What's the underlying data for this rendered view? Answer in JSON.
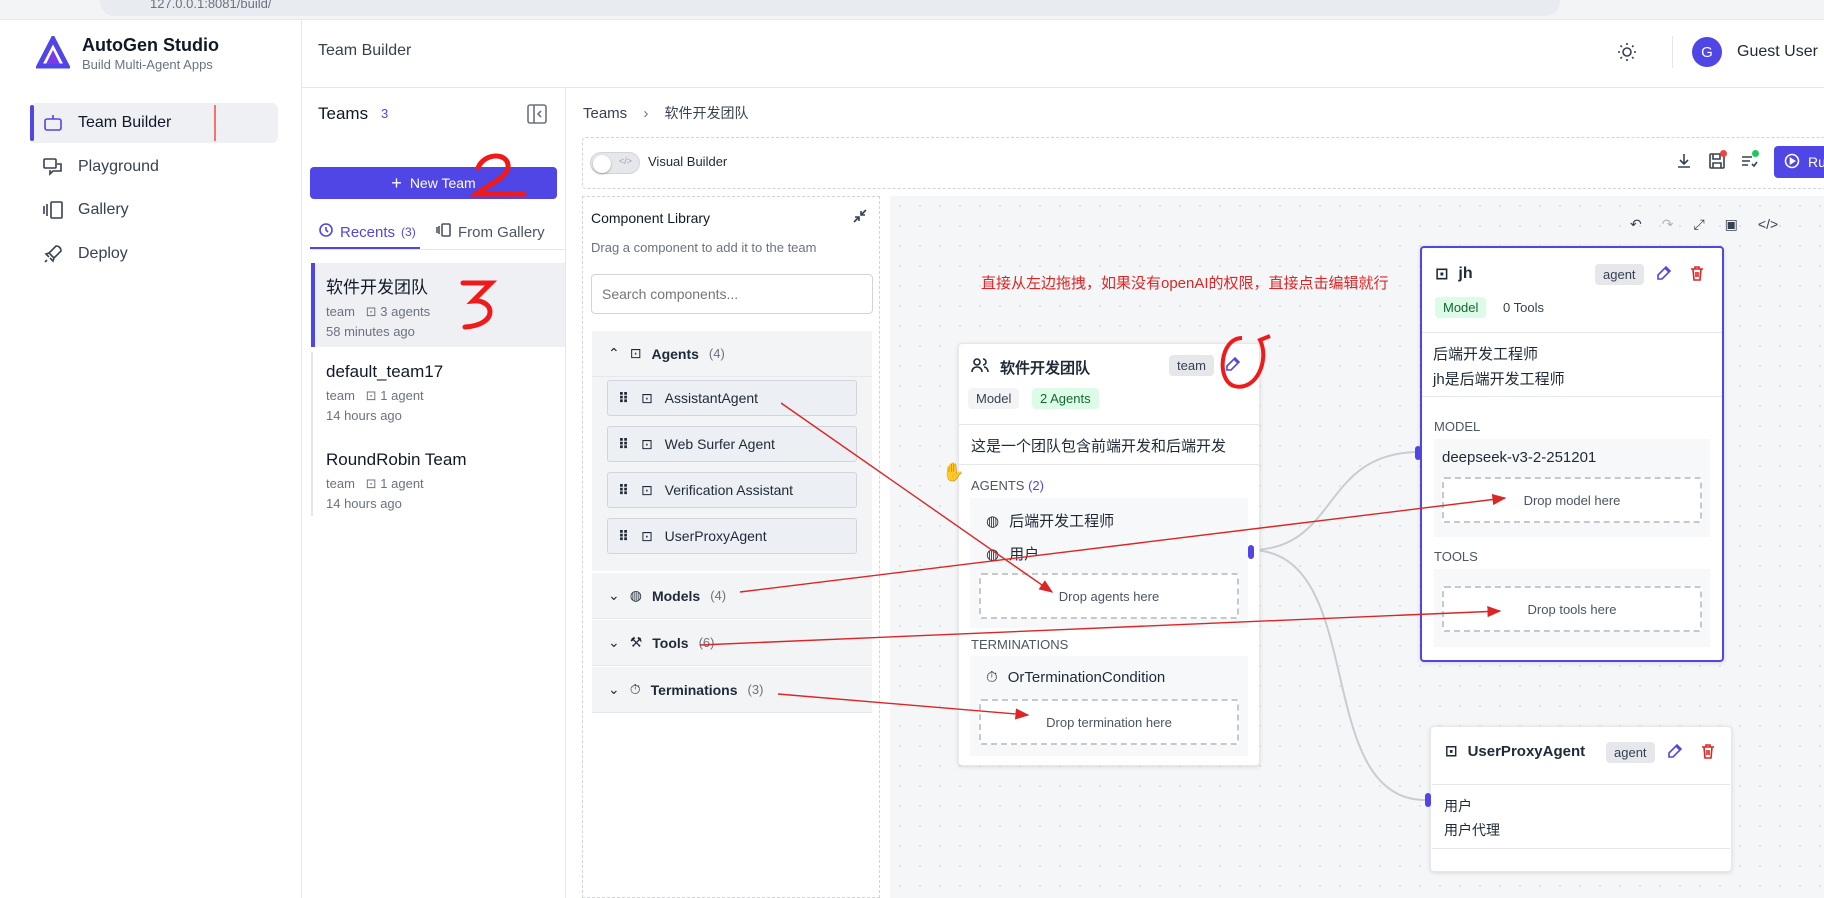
{
  "browser": {
    "url": "127.0.0.1:8081/build/"
  },
  "app": {
    "title": "AutoGen Studio",
    "subtitle": "Build Multi-Agent Apps"
  },
  "nav": {
    "items": [
      {
        "label": "Team Builder",
        "icon": "bot-icon",
        "active": true
      },
      {
        "label": "Playground",
        "icon": "chat-icon",
        "active": false
      },
      {
        "label": "Gallery",
        "icon": "gallery-icon",
        "active": false
      },
      {
        "label": "Deploy",
        "icon": "rocket-icon",
        "active": false
      }
    ]
  },
  "header": {
    "title": "Team Builder",
    "user_initial": "G",
    "user_name": "Guest User"
  },
  "teams": {
    "title": "Teams",
    "count": "3",
    "new_team_label": "New Team",
    "tabs": {
      "recents_label": "Recents",
      "recents_count": "(3)",
      "gallery_label": "From Gallery"
    },
    "list": [
      {
        "name": "软件开发团队",
        "type": "team",
        "agents": "3 agents",
        "time": "58 minutes ago"
      },
      {
        "name": "default_team17",
        "type": "team",
        "agents": "1 agent",
        "time": "14 hours ago"
      },
      {
        "name": "RoundRobin Team",
        "type": "team",
        "agents": "1 agent",
        "time": "14 hours ago"
      }
    ]
  },
  "breadcrumb": {
    "root": "Teams",
    "current": "软件开发团队"
  },
  "toolbar": {
    "visual_builder_label": "Visual Builder",
    "run_label": "Ru"
  },
  "library": {
    "title": "Component Library",
    "subtitle": "Drag a component to add it to the team",
    "search_placeholder": "Search components...",
    "sections": {
      "agents": {
        "label": "Agents",
        "count": "(4)"
      },
      "models": {
        "label": "Models",
        "count": "(4)"
      },
      "tools": {
        "label": "Tools",
        "count": "(6)"
      },
      "terminations": {
        "label": "Terminations",
        "count": "(3)"
      }
    },
    "agents": [
      "AssistantAgent",
      "Web Surfer Agent",
      "Verification Assistant",
      "UserProxyAgent"
    ]
  },
  "annotation": {
    "text": "直接从左边拖拽，如果没有openAI的权限，直接点击编辑就行",
    "color": "#dc2626"
  },
  "team_node": {
    "name": "软件开发团队",
    "badge": "team",
    "model_label": "Model",
    "agents_badge": "2 Agents",
    "description": "这是一个团队包含前端开发和后端开发",
    "agents_title": "AGENTS",
    "agents_count": "(2)",
    "agents": [
      "后端开发工程师",
      "用户"
    ],
    "drop_agents": "Drop agents here",
    "terminations_title": "TERMINATIONS",
    "termination": "OrTerminationCondition",
    "drop_termination": "Drop termination here"
  },
  "jh_node": {
    "name": "jh",
    "badge": "agent",
    "model_badge": "Model",
    "tools_badge": "0 Tools",
    "line1": "后端开发工程师",
    "line2": "jh是后端开发工程师",
    "model_title": "MODEL",
    "model_value": "deepseek-v3-2-251201",
    "drop_model": "Drop model here",
    "tools_title": "TOOLS",
    "drop_tools": "Drop tools here"
  },
  "proxy_node": {
    "name": "UserProxyAgent",
    "badge": "agent",
    "line1": "用户",
    "line2": "用户代理"
  },
  "colors": {
    "accent": "#4f46e5",
    "annotation_red": "#dc2626"
  }
}
